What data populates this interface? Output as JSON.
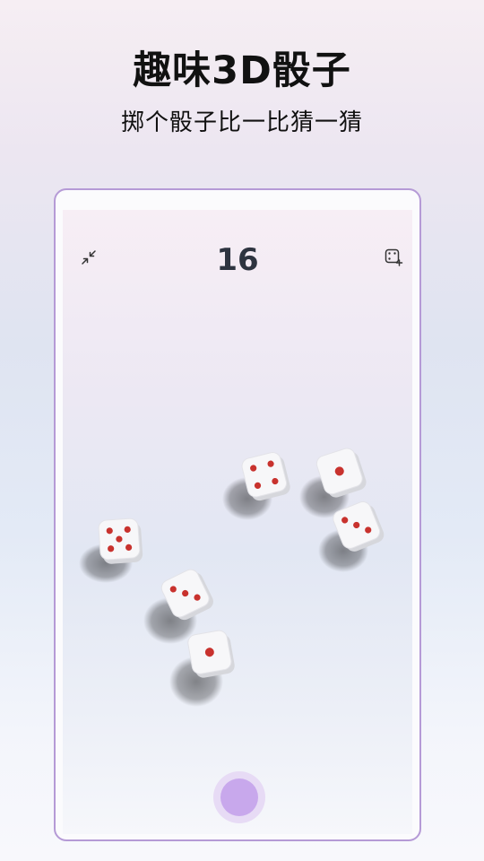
{
  "promo": {
    "title": "趣味3D骰子",
    "subtitle": "掷个骰子比一比猜一猜"
  },
  "game": {
    "score": "16",
    "collapse_icon": "collapse-arrows-icon",
    "dice_settings_icon": "dice-add-icon",
    "roll_button_icon": "roll-circle-icon",
    "dice": [
      {
        "face": 5
      },
      {
        "face": 1
      },
      {
        "face": 4
      },
      {
        "face": 3
      },
      {
        "face": 3
      },
      {
        "face": 1
      }
    ]
  },
  "colors": {
    "frame": "#b59ad6",
    "pip": "#c8322e",
    "roll_button": "#c8a8ec",
    "score_text": "#2e3440"
  }
}
